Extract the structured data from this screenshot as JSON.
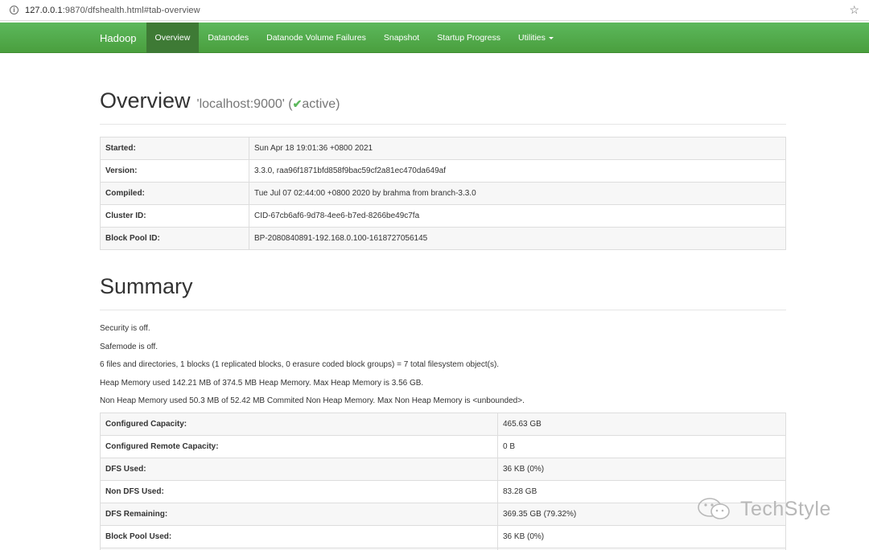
{
  "browser": {
    "url_host": "127.0.0.1",
    "url_rest": ":9870/dfshealth.html#tab-overview"
  },
  "navbar": {
    "brand": "Hadoop",
    "items": [
      {
        "label": "Overview",
        "active": true
      },
      {
        "label": "Datanodes"
      },
      {
        "label": "Datanode Volume Failures"
      },
      {
        "label": "Snapshot"
      },
      {
        "label": "Startup Progress"
      },
      {
        "label": "Utilities"
      }
    ]
  },
  "overview": {
    "title": "Overview",
    "host": "'localhost:9000' (",
    "status": "active",
    "status_close": ")",
    "rows": [
      {
        "key": "Started:",
        "value": "Sun Apr 18 19:01:36 +0800 2021"
      },
      {
        "key": "Version:",
        "value": "3.3.0, raa96f1871bfd858f9bac59cf2a81ec470da649af"
      },
      {
        "key": "Compiled:",
        "value": "Tue Jul 07 02:44:00 +0800 2020 by brahma from branch-3.3.0"
      },
      {
        "key": "Cluster ID:",
        "value": "CID-67cb6af6-9d78-4ee6-b7ed-8266be49c7fa"
      },
      {
        "key": "Block Pool ID:",
        "value": "BP-2080840891-192.168.0.100-1618727056145"
      }
    ]
  },
  "summary": {
    "title": "Summary",
    "lines": [
      "Security is off.",
      "Safemode is off.",
      "6 files and directories, 1 blocks (1 replicated blocks, 0 erasure coded block groups) = 7 total filesystem object(s).",
      "Heap Memory used 142.21 MB of 374.5 MB Heap Memory. Max Heap Memory is 3.56 GB.",
      "Non Heap Memory used 50.3 MB of 52.42 MB Commited Non Heap Memory. Max Non Heap Memory is <unbounded>."
    ],
    "rows": [
      {
        "key": "Configured Capacity:",
        "value": "465.63 GB"
      },
      {
        "key": "Configured Remote Capacity:",
        "value": "0 B"
      },
      {
        "key": "DFS Used:",
        "value": "36 KB (0%)"
      },
      {
        "key": "Non DFS Used:",
        "value": "83.28 GB"
      },
      {
        "key": "DFS Remaining:",
        "value": "369.35 GB (79.32%)"
      },
      {
        "key": "Block Pool Used:",
        "value": "36 KB (0%)"
      },
      {
        "key": "",
        "value": ""
      }
    ]
  },
  "watermark": {
    "text": "TechStyle"
  },
  "colors": {
    "navbar": "#5cb85c",
    "navbar_active": "#3e7a35",
    "check": "#5cb85c"
  }
}
